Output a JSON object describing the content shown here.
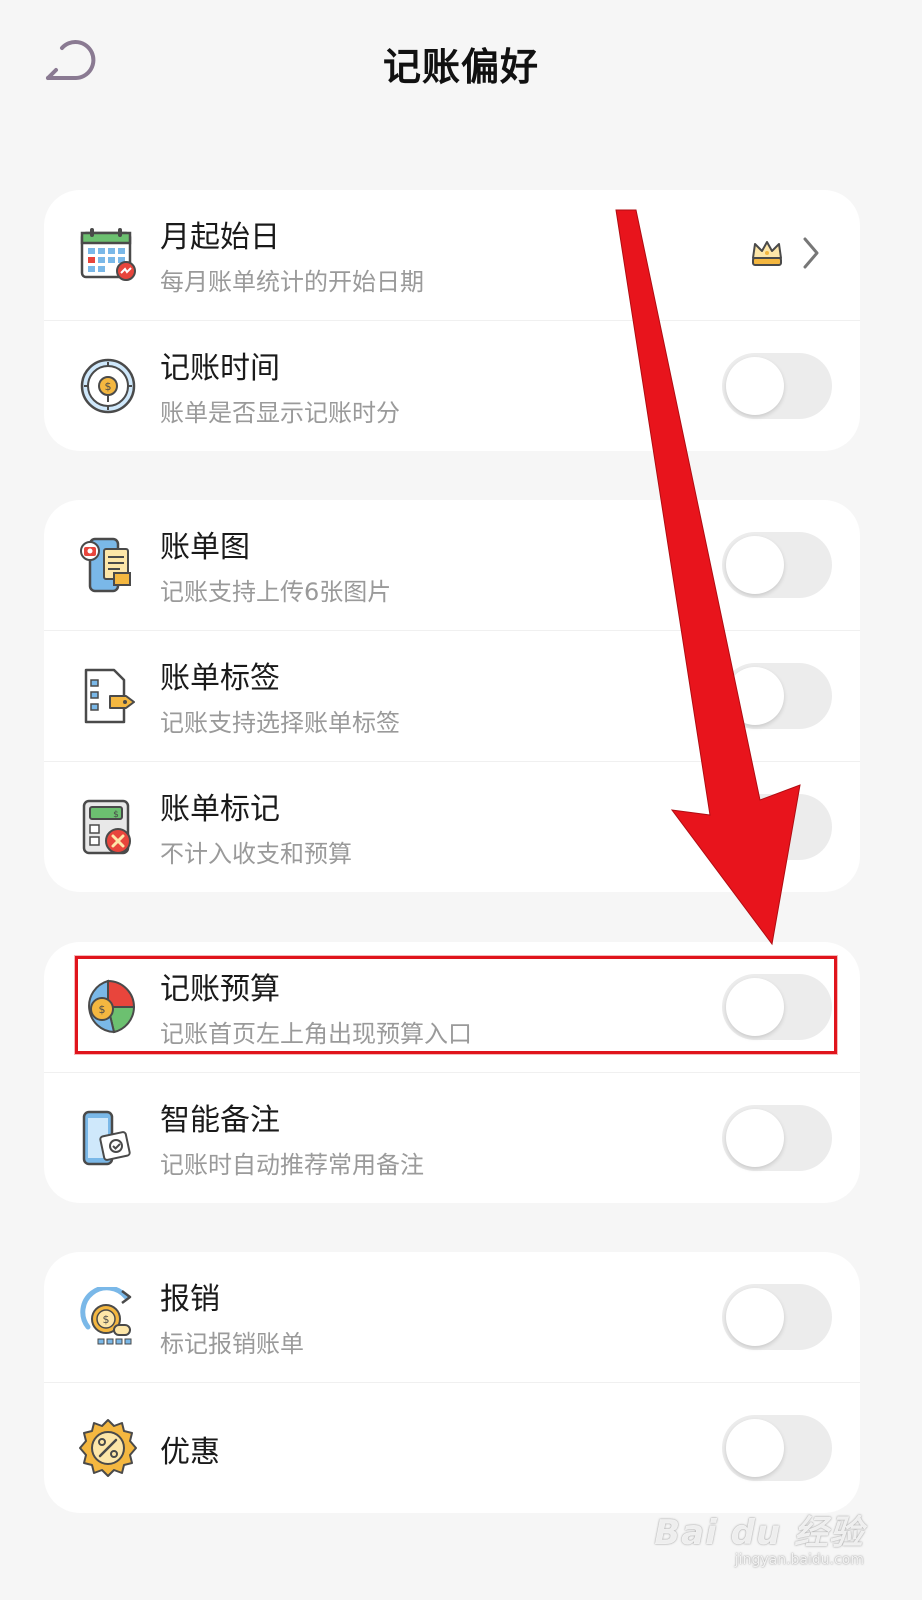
{
  "header": {
    "title": "记账偏好"
  },
  "sections": [
    {
      "rows": [
        {
          "title": "月起始日",
          "subtitle": "每月账单统计的开始日期",
          "icon": "calendar-icon",
          "control": "chevron"
        },
        {
          "title": "记账时间",
          "subtitle": "账单是否显示记账时分",
          "icon": "clock-icon",
          "control": "toggle",
          "on": false
        }
      ]
    },
    {
      "rows": [
        {
          "title": "账单图",
          "subtitle": "记账支持上传6张图片",
          "icon": "photo-receipt-icon",
          "control": "toggle",
          "on": false
        },
        {
          "title": "账单标签",
          "subtitle": "记账支持选择账单标签",
          "icon": "tag-list-icon",
          "control": "toggle",
          "on": false
        },
        {
          "title": "账单标记",
          "subtitle": "不计入收支和预算",
          "icon": "calculator-icon",
          "control": "toggle",
          "on": false
        }
      ]
    },
    {
      "rows": [
        {
          "title": "记账预算",
          "subtitle": "记账首页左上角出现预算入口",
          "icon": "budget-pie-icon",
          "control": "toggle",
          "on": false
        },
        {
          "title": "智能备注",
          "subtitle": "记账时自动推荐常用备注",
          "icon": "smart-note-icon",
          "control": "toggle",
          "on": false
        }
      ]
    },
    {
      "rows": [
        {
          "title": "报销",
          "subtitle": "标记报销账单",
          "icon": "reimburse-coin-icon",
          "control": "toggle",
          "on": false
        },
        {
          "title": "优惠",
          "subtitle": "",
          "icon": "discount-badge-icon",
          "control": "toggle",
          "on": false
        }
      ]
    }
  ],
  "colors": {
    "background": "#f6f6f6",
    "card": "#ffffff",
    "toggle_off": "#ececec",
    "annotation_red": "#e0141c"
  },
  "watermark": {
    "brand": "Bai du 经验",
    "url": "jingyan.baidu.com"
  }
}
